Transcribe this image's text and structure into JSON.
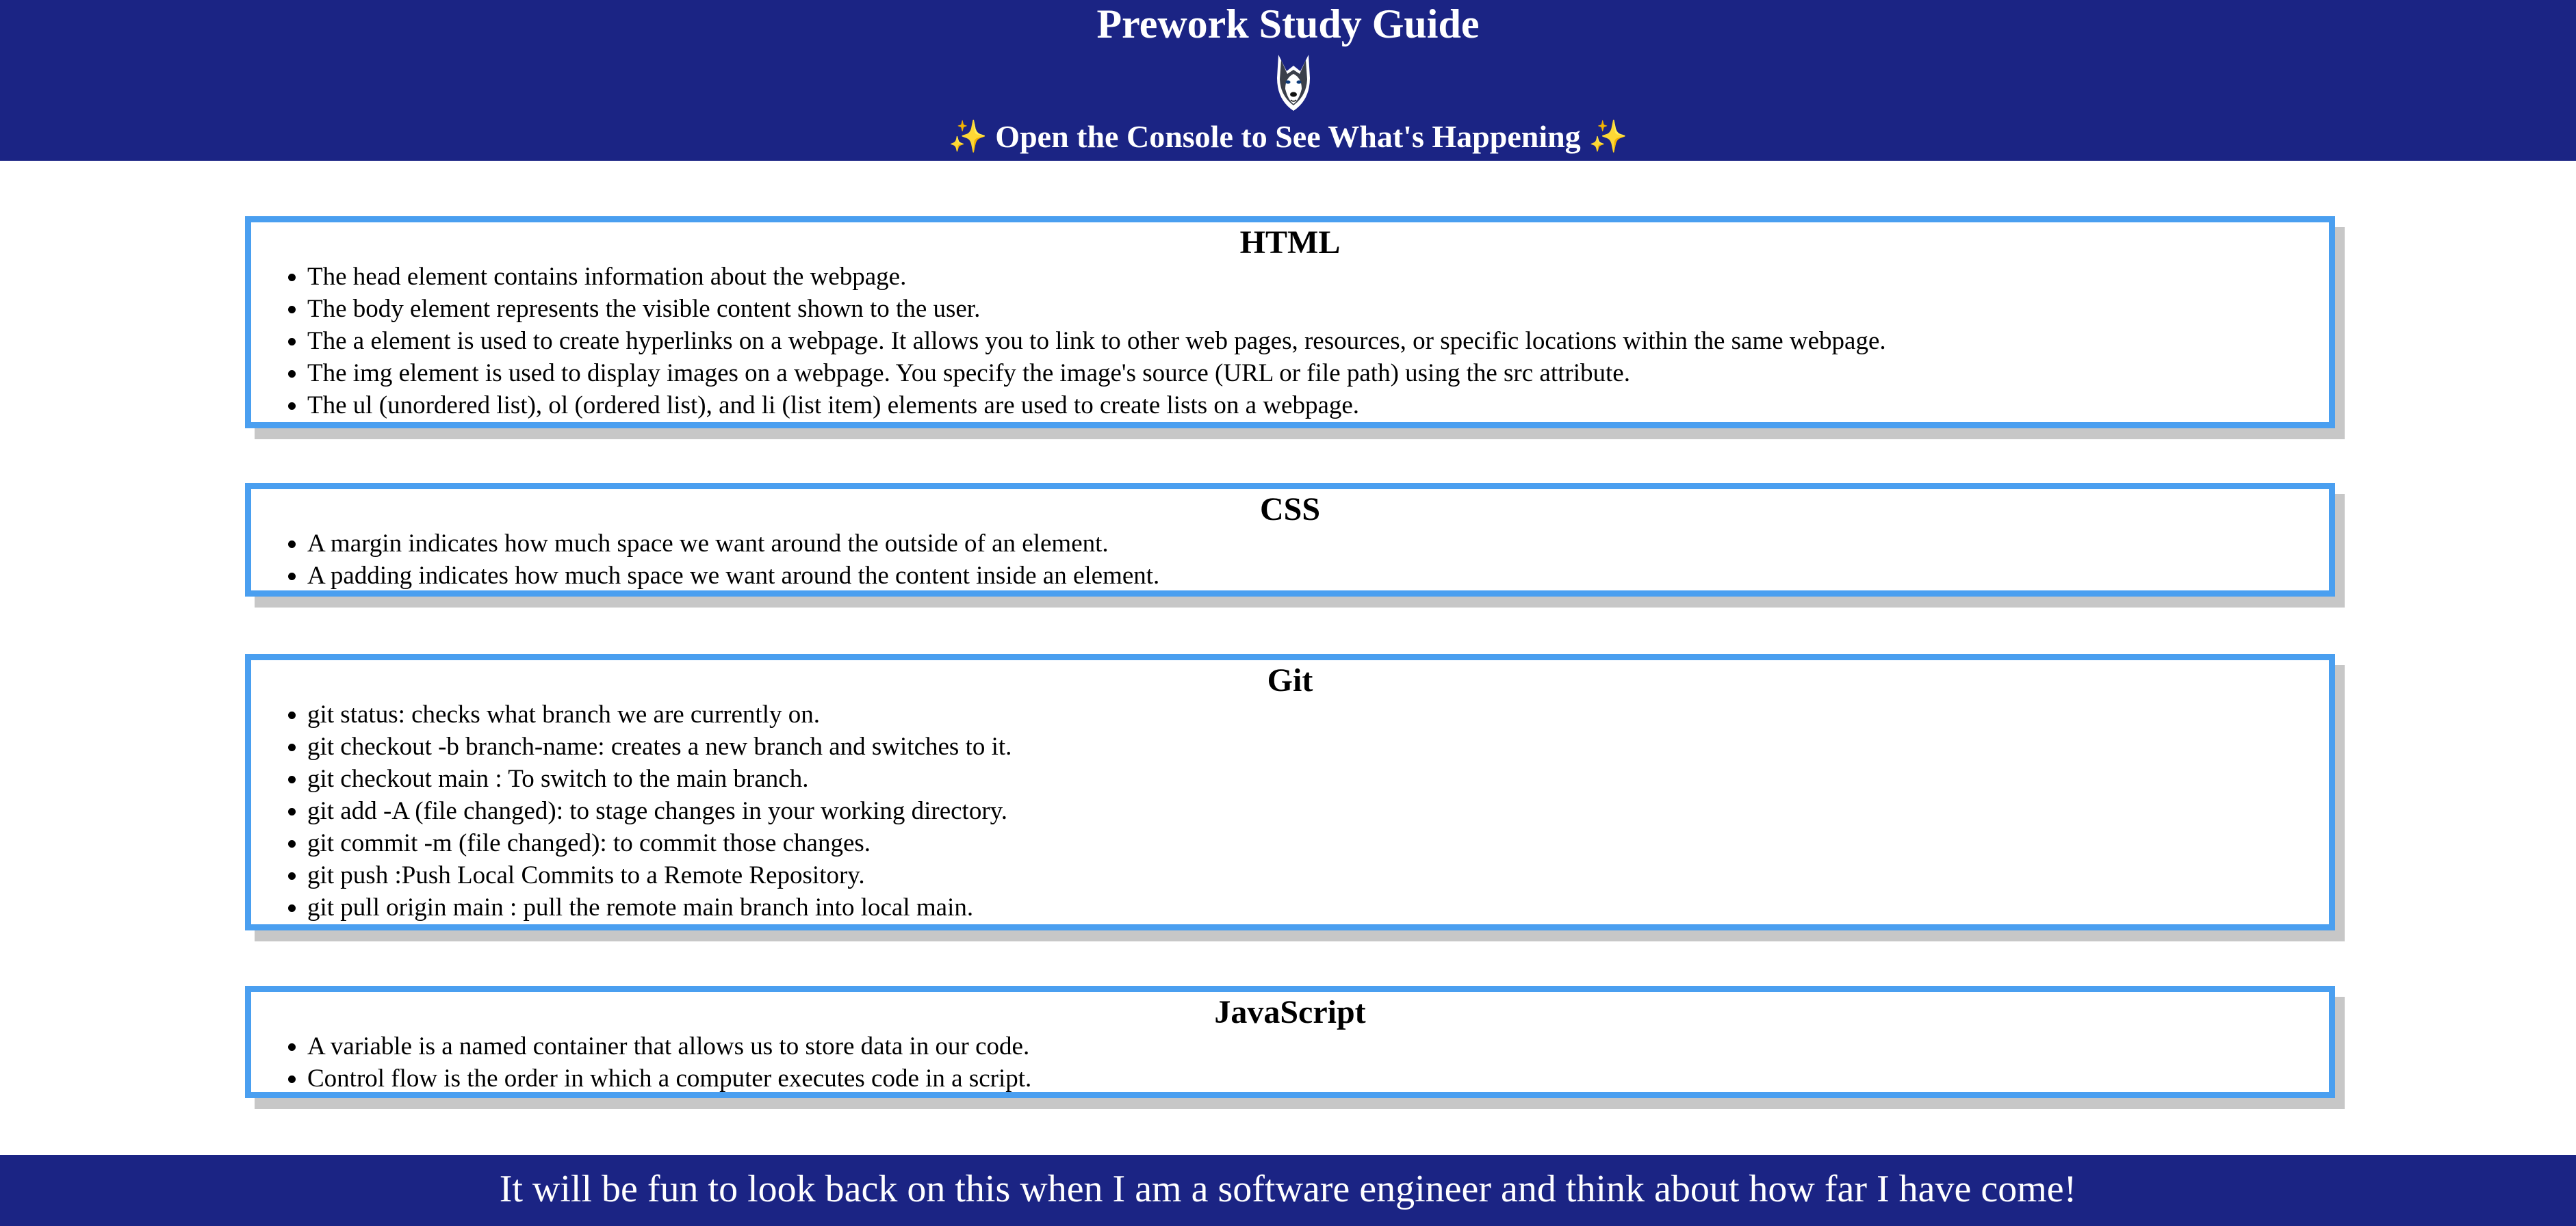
{
  "header": {
    "title": "Prework Study Guide",
    "logo_icon": "husky-logo-icon",
    "subtitle_left_icon": "✨",
    "subtitle": "Open the Console to See What's Happening",
    "subtitle_right_icon": "✨",
    "background_color": "#1b2484"
  },
  "sections": [
    {
      "title": "HTML",
      "items": [
        "The head element contains information about the webpage.",
        "The body element represents the visible content shown to the user.",
        "The a element is used to create hyperlinks on a webpage. It allows you to link to other web pages, resources, or specific locations within the same webpage.",
        "The img element is used to display images on a webpage. You specify the image's source (URL or file path) using the src attribute.",
        "The ul (unordered list), ol (ordered list), and li (list item) elements are used to create lists on a webpage."
      ]
    },
    {
      "title": "CSS",
      "items": [
        "A margin indicates how much space we want around the outside of an element.",
        "A padding indicates how much space we want around the content inside an element."
      ]
    },
    {
      "title": "Git",
      "items": [
        "git status: checks what branch we are currently on.",
        "git checkout -b branch-name: creates a new branch and switches to it.",
        "git checkout main : To switch to the main branch.",
        "git add -A (file changed): to stage changes in your working directory.",
        "git commit -m (file changed): to commit those changes.",
        "git push :Push Local Commits to a Remote Repository.",
        "git pull origin main : pull the remote main branch into local main."
      ]
    },
    {
      "title": "JavaScript",
      "items": [
        "A variable is a named container that allows us to store data in our code.",
        "Control flow is the order in which a computer executes code in a script."
      ]
    }
  ],
  "footer": {
    "text": "It will be fun to look back on this when I am a software engineer and think about how far I have come!"
  },
  "colors": {
    "card_border": "#4a9ff0",
    "card_shadow": "#c7c7c7",
    "sparkle": "#f6c34a"
  }
}
